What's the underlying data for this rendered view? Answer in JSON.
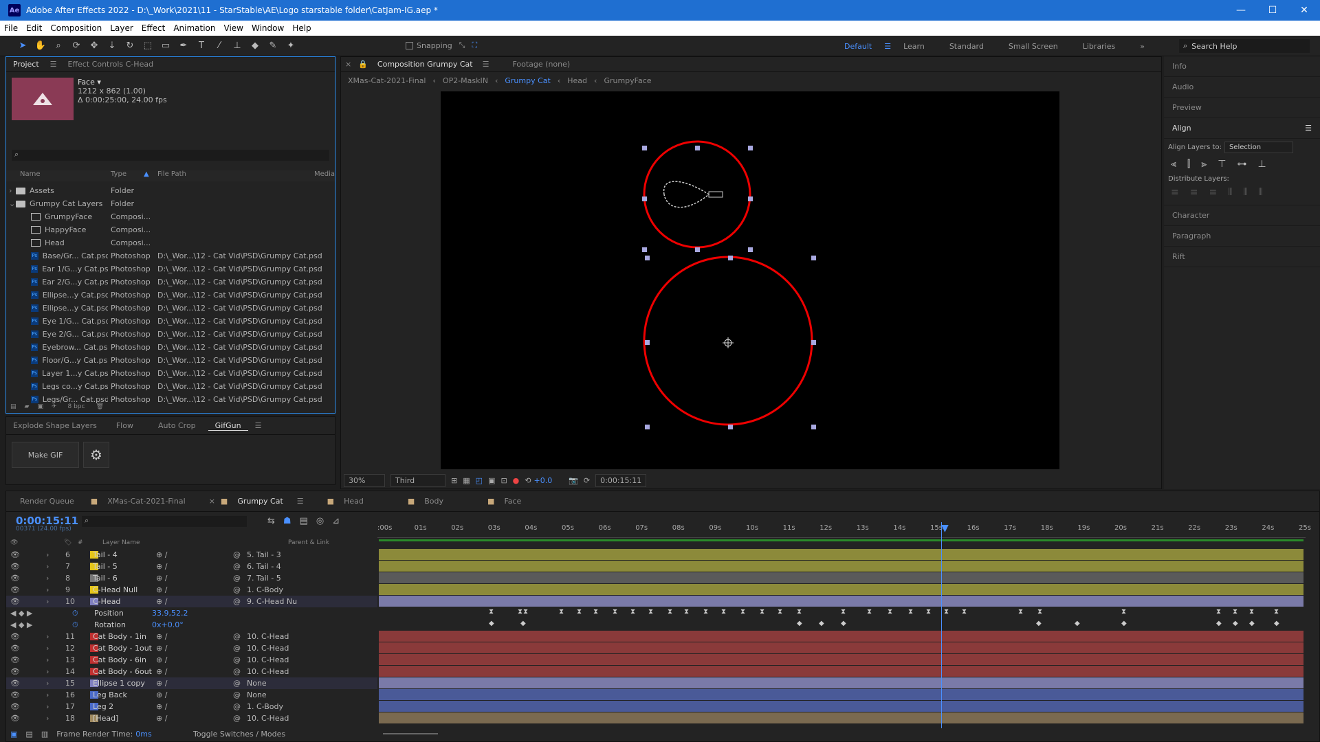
{
  "window": {
    "title": "Adobe After Effects 2022 - D:\\_Work\\2021\\11 - StarStable\\AE\\Logo starstable folder\\CatJam-IG.aep *",
    "app_icon": "Ae",
    "controls": [
      "—",
      "☐",
      "✕"
    ]
  },
  "menu": [
    "File",
    "Edit",
    "Composition",
    "Layer",
    "Effect",
    "Animation",
    "View",
    "Window",
    "Help"
  ],
  "toolbar": {
    "snapping": "Snapping",
    "workspaces": [
      "Default",
      "Learn",
      "Standard",
      "Small Screen",
      "Libraries"
    ],
    "active_workspace": "Default",
    "search": "Search Help"
  },
  "project": {
    "tabs": [
      "Project",
      "Effect Controls C-Head"
    ],
    "selected_name": "Face ▾",
    "selected_info1": "1212 x 862 (1.00)",
    "selected_info2": "Δ 0:00:25:00, 24.00 fps",
    "columns": [
      "Name",
      "Type",
      "File Path",
      "Media"
    ],
    "rows": [
      {
        "icon": "folder",
        "name": "Assets",
        "type": "Folder",
        "path": "",
        "indent": 0,
        "tw": "›"
      },
      {
        "icon": "folder",
        "name": "Grumpy Cat Layers",
        "type": "Folder",
        "path": "",
        "indent": 0,
        "tw": "⌄"
      },
      {
        "icon": "comp",
        "name": "GrumpyFace",
        "type": "Composi...",
        "path": "",
        "indent": 1,
        "tw": ""
      },
      {
        "icon": "comp",
        "name": "HappyFace",
        "type": "Composi...",
        "path": "",
        "indent": 1,
        "tw": ""
      },
      {
        "icon": "comp",
        "name": "Head",
        "type": "Composi...",
        "path": "",
        "indent": 1,
        "tw": ""
      },
      {
        "icon": "ps",
        "name": "Base/Gr... Cat.psd",
        "type": "Photoshop",
        "path": "D:\\_Wor...\\12 - Cat Vid\\PSD\\Grumpy Cat.psd",
        "indent": 1,
        "tw": ""
      },
      {
        "icon": "ps",
        "name": "Ear 1/G...y Cat.psd",
        "type": "Photoshop",
        "path": "D:\\_Wor...\\12 - Cat Vid\\PSD\\Grumpy Cat.psd",
        "indent": 1,
        "tw": ""
      },
      {
        "icon": "ps",
        "name": "Ear 2/G...y Cat.psd",
        "type": "Photoshop",
        "path": "D:\\_Wor...\\12 - Cat Vid\\PSD\\Grumpy Cat.psd",
        "indent": 1,
        "tw": ""
      },
      {
        "icon": "ps",
        "name": "Ellipse...y Cat.psd",
        "type": "Photoshop",
        "path": "D:\\_Wor...\\12 - Cat Vid\\PSD\\Grumpy Cat.psd",
        "indent": 1,
        "tw": ""
      },
      {
        "icon": "ps",
        "name": "Ellipse...y Cat.psd",
        "type": "Photoshop",
        "path": "D:\\_Wor...\\12 - Cat Vid\\PSD\\Grumpy Cat.psd",
        "indent": 1,
        "tw": ""
      },
      {
        "icon": "ps",
        "name": "Eye 1/G... Cat.psd",
        "type": "Photoshop",
        "path": "D:\\_Wor...\\12 - Cat Vid\\PSD\\Grumpy Cat.psd",
        "indent": 1,
        "tw": ""
      },
      {
        "icon": "ps",
        "name": "Eye 2/G... Cat.psd",
        "type": "Photoshop",
        "path": "D:\\_Wor...\\12 - Cat Vid\\PSD\\Grumpy Cat.psd",
        "indent": 1,
        "tw": ""
      },
      {
        "icon": "ps",
        "name": "Eyebrow... Cat.psd",
        "type": "Photoshop",
        "path": "D:\\_Wor...\\12 - Cat Vid\\PSD\\Grumpy Cat.psd",
        "indent": 1,
        "tw": ""
      },
      {
        "icon": "ps",
        "name": "Floor/G...y Cat.psd",
        "type": "Photoshop",
        "path": "D:\\_Wor...\\12 - Cat Vid\\PSD\\Grumpy Cat.psd",
        "indent": 1,
        "tw": ""
      },
      {
        "icon": "ps",
        "name": "Layer 1...y Cat.psd",
        "type": "Photoshop",
        "path": "D:\\_Wor...\\12 - Cat Vid\\PSD\\Grumpy Cat.psd",
        "indent": 1,
        "tw": ""
      },
      {
        "icon": "ps",
        "name": "Legs co...y Cat.psd",
        "type": "Photoshop",
        "path": "D:\\_Wor...\\12 - Cat Vid\\PSD\\Grumpy Cat.psd",
        "indent": 1,
        "tw": ""
      },
      {
        "icon": "ps",
        "name": "Legs/Gr... Cat.psd",
        "type": "Photoshop",
        "path": "D:\\_Wor...\\12 - Cat Vid\\PSD\\Grumpy Cat.psd",
        "indent": 1,
        "tw": ""
      }
    ],
    "bpc": "8 bpc"
  },
  "gifgun": {
    "tabs": [
      "Explode Shape Layers",
      "Flow",
      "Auto Crop",
      "GifGun"
    ],
    "make_gif": "Make GIF"
  },
  "comp": {
    "tabs": [
      "Composition Grumpy Cat",
      "Footage (none)"
    ],
    "breadcrumbs": [
      "XMas-Cat-2021-Final",
      "OP2-MaskIN",
      "Grumpy Cat",
      "Head",
      "GrumpyFace"
    ],
    "zoom": "30%",
    "view": "Third",
    "exposure": "+0.0",
    "timecode": "0:00:15:11"
  },
  "right_panel": {
    "sections": [
      "Info",
      "Audio",
      "Preview",
      "Align"
    ],
    "align_to_label": "Align Layers to:",
    "align_to_value": "Selection",
    "distribute": "Distribute Layers:",
    "more": [
      "Character",
      "Paragraph",
      "Rift"
    ]
  },
  "timeline": {
    "tabs": [
      "Render Queue",
      "XMas-Cat-2021-Final",
      "Grumpy Cat",
      "Head",
      "Body",
      "Face"
    ],
    "timecode": "0:00:15:11",
    "sub": "00371 (24.00 fps)",
    "ticks": [
      ":00s",
      "01s",
      "02s",
      "03s",
      "04s",
      "05s",
      "06s",
      "07s",
      "08s",
      "09s",
      "10s",
      "11s",
      "12s",
      "13s",
      "14s",
      "15s",
      "16s",
      "17s",
      "18s",
      "19s",
      "20s",
      "21s",
      "22s",
      "23s",
      "24s",
      "25s"
    ],
    "col_layer_name": "Layer Name",
    "col_parent": "Parent & Link",
    "col_num": "#",
    "layers": [
      {
        "num": "6",
        "name": "Tail - 4",
        "parent": "5. Tail - 3",
        "color": "#e6c619",
        "bar": "#8c8a3a"
      },
      {
        "num": "7",
        "name": "Tail - 5",
        "parent": "6. Tail - 4",
        "color": "#e6c619",
        "bar": "#8c8a3a"
      },
      {
        "num": "8",
        "name": "Tail - 6",
        "parent": "7. Tail - 5",
        "color": "#777777",
        "bar": "#5a5a5a"
      },
      {
        "num": "9",
        "name": "C-Head Null",
        "parent": "1. C-Body",
        "color": "#e6c619",
        "bar": "#8c8a3a"
      },
      {
        "num": "10",
        "name": "C-Head",
        "parent": "9. C-Head Nu",
        "color": "#8080c0",
        "bar": "#7a7aa8"
      },
      {
        "num": "11",
        "name": "Cat Body - 1in",
        "parent": "10. C-Head",
        "color": "#c03030",
        "bar": "#8a3a3a"
      },
      {
        "num": "12",
        "name": "Cat Body - 1out",
        "parent": "10. C-Head",
        "color": "#c03030",
        "bar": "#8a3a3a"
      },
      {
        "num": "13",
        "name": "Cat Body - 6in",
        "parent": "10. C-Head",
        "color": "#c03030",
        "bar": "#8a3a3a"
      },
      {
        "num": "14",
        "name": "Cat Body - 6out",
        "parent": "10. C-Head",
        "color": "#c03030",
        "bar": "#8a3a3a"
      },
      {
        "num": "15",
        "name": "Ellipse 1 copy",
        "parent": "None",
        "color": "#8080c0",
        "bar": "#7a7aa8"
      },
      {
        "num": "16",
        "name": "Leg Back",
        "parent": "None",
        "color": "#4a6ac8",
        "bar": "#4a5a98"
      },
      {
        "num": "17",
        "name": "Leg 2",
        "parent": "1. C-Body",
        "color": "#4a6ac8",
        "bar": "#4a5a98"
      },
      {
        "num": "18",
        "name": "[Head]",
        "parent": "10. C-Head",
        "color": "#a08a60",
        "bar": "#7a6a50"
      }
    ],
    "props": [
      {
        "name": "Position",
        "value": "33.9,52.2"
      },
      {
        "name": "Rotation",
        "value": "0x+0.0°"
      }
    ],
    "frame_render": "Frame Render Time:",
    "frame_render_val": "0ms",
    "toggle": "Toggle Switches / Modes"
  }
}
